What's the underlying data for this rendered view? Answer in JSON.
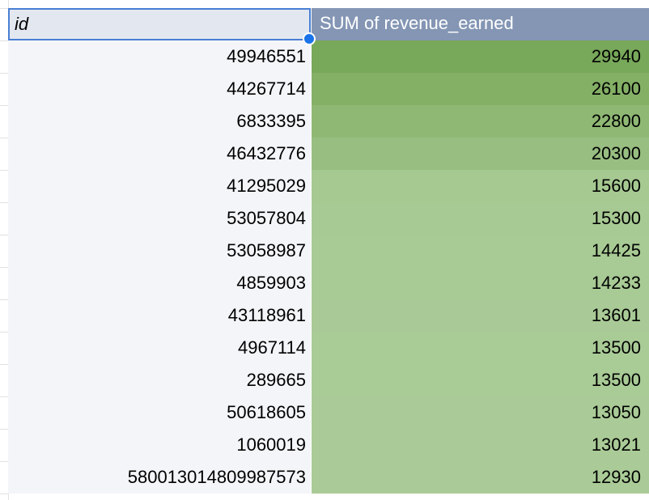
{
  "header": {
    "id_label": "id",
    "revenue_label": "SUM of revenue_earned"
  },
  "colors": {
    "header_id_bg": "#e3e8f0",
    "header_revenue_bg": "#8496b4",
    "selection_border": "#4a7fd4",
    "scale_high": "#78a85a",
    "scale_low": "#aacb97"
  },
  "rows": [
    {
      "id": "49946551",
      "revenue": "29940",
      "color": "#78a85a"
    },
    {
      "id": "44267714",
      "revenue": "26100",
      "color": "#84b066"
    },
    {
      "id": "6833395",
      "revenue": "22800",
      "color": "#8fb874"
    },
    {
      "id": "46432776",
      "revenue": "20300",
      "color": "#98be81"
    },
    {
      "id": "41295029",
      "revenue": "15600",
      "color": "#a6c992"
    },
    {
      "id": "53057804",
      "revenue": "15300",
      "color": "#a7c993"
    },
    {
      "id": "53058987",
      "revenue": "14425",
      "color": "#a8ca94"
    },
    {
      "id": "4859903",
      "revenue": "14233",
      "color": "#a8ca95"
    },
    {
      "id": "43118961",
      "revenue": "13601",
      "color": "#a9ca96"
    },
    {
      "id": "4967114",
      "revenue": "13500",
      "color": "#a9cb96"
    },
    {
      "id": "289665",
      "revenue": "13500",
      "color": "#a9cb96"
    },
    {
      "id": "50618605",
      "revenue": "13050",
      "color": "#aacb97"
    },
    {
      "id": "1060019",
      "revenue": "13021",
      "color": "#aacb97"
    },
    {
      "id": "580013014809987573",
      "revenue": "12930",
      "color": "#aacb97"
    }
  ]
}
